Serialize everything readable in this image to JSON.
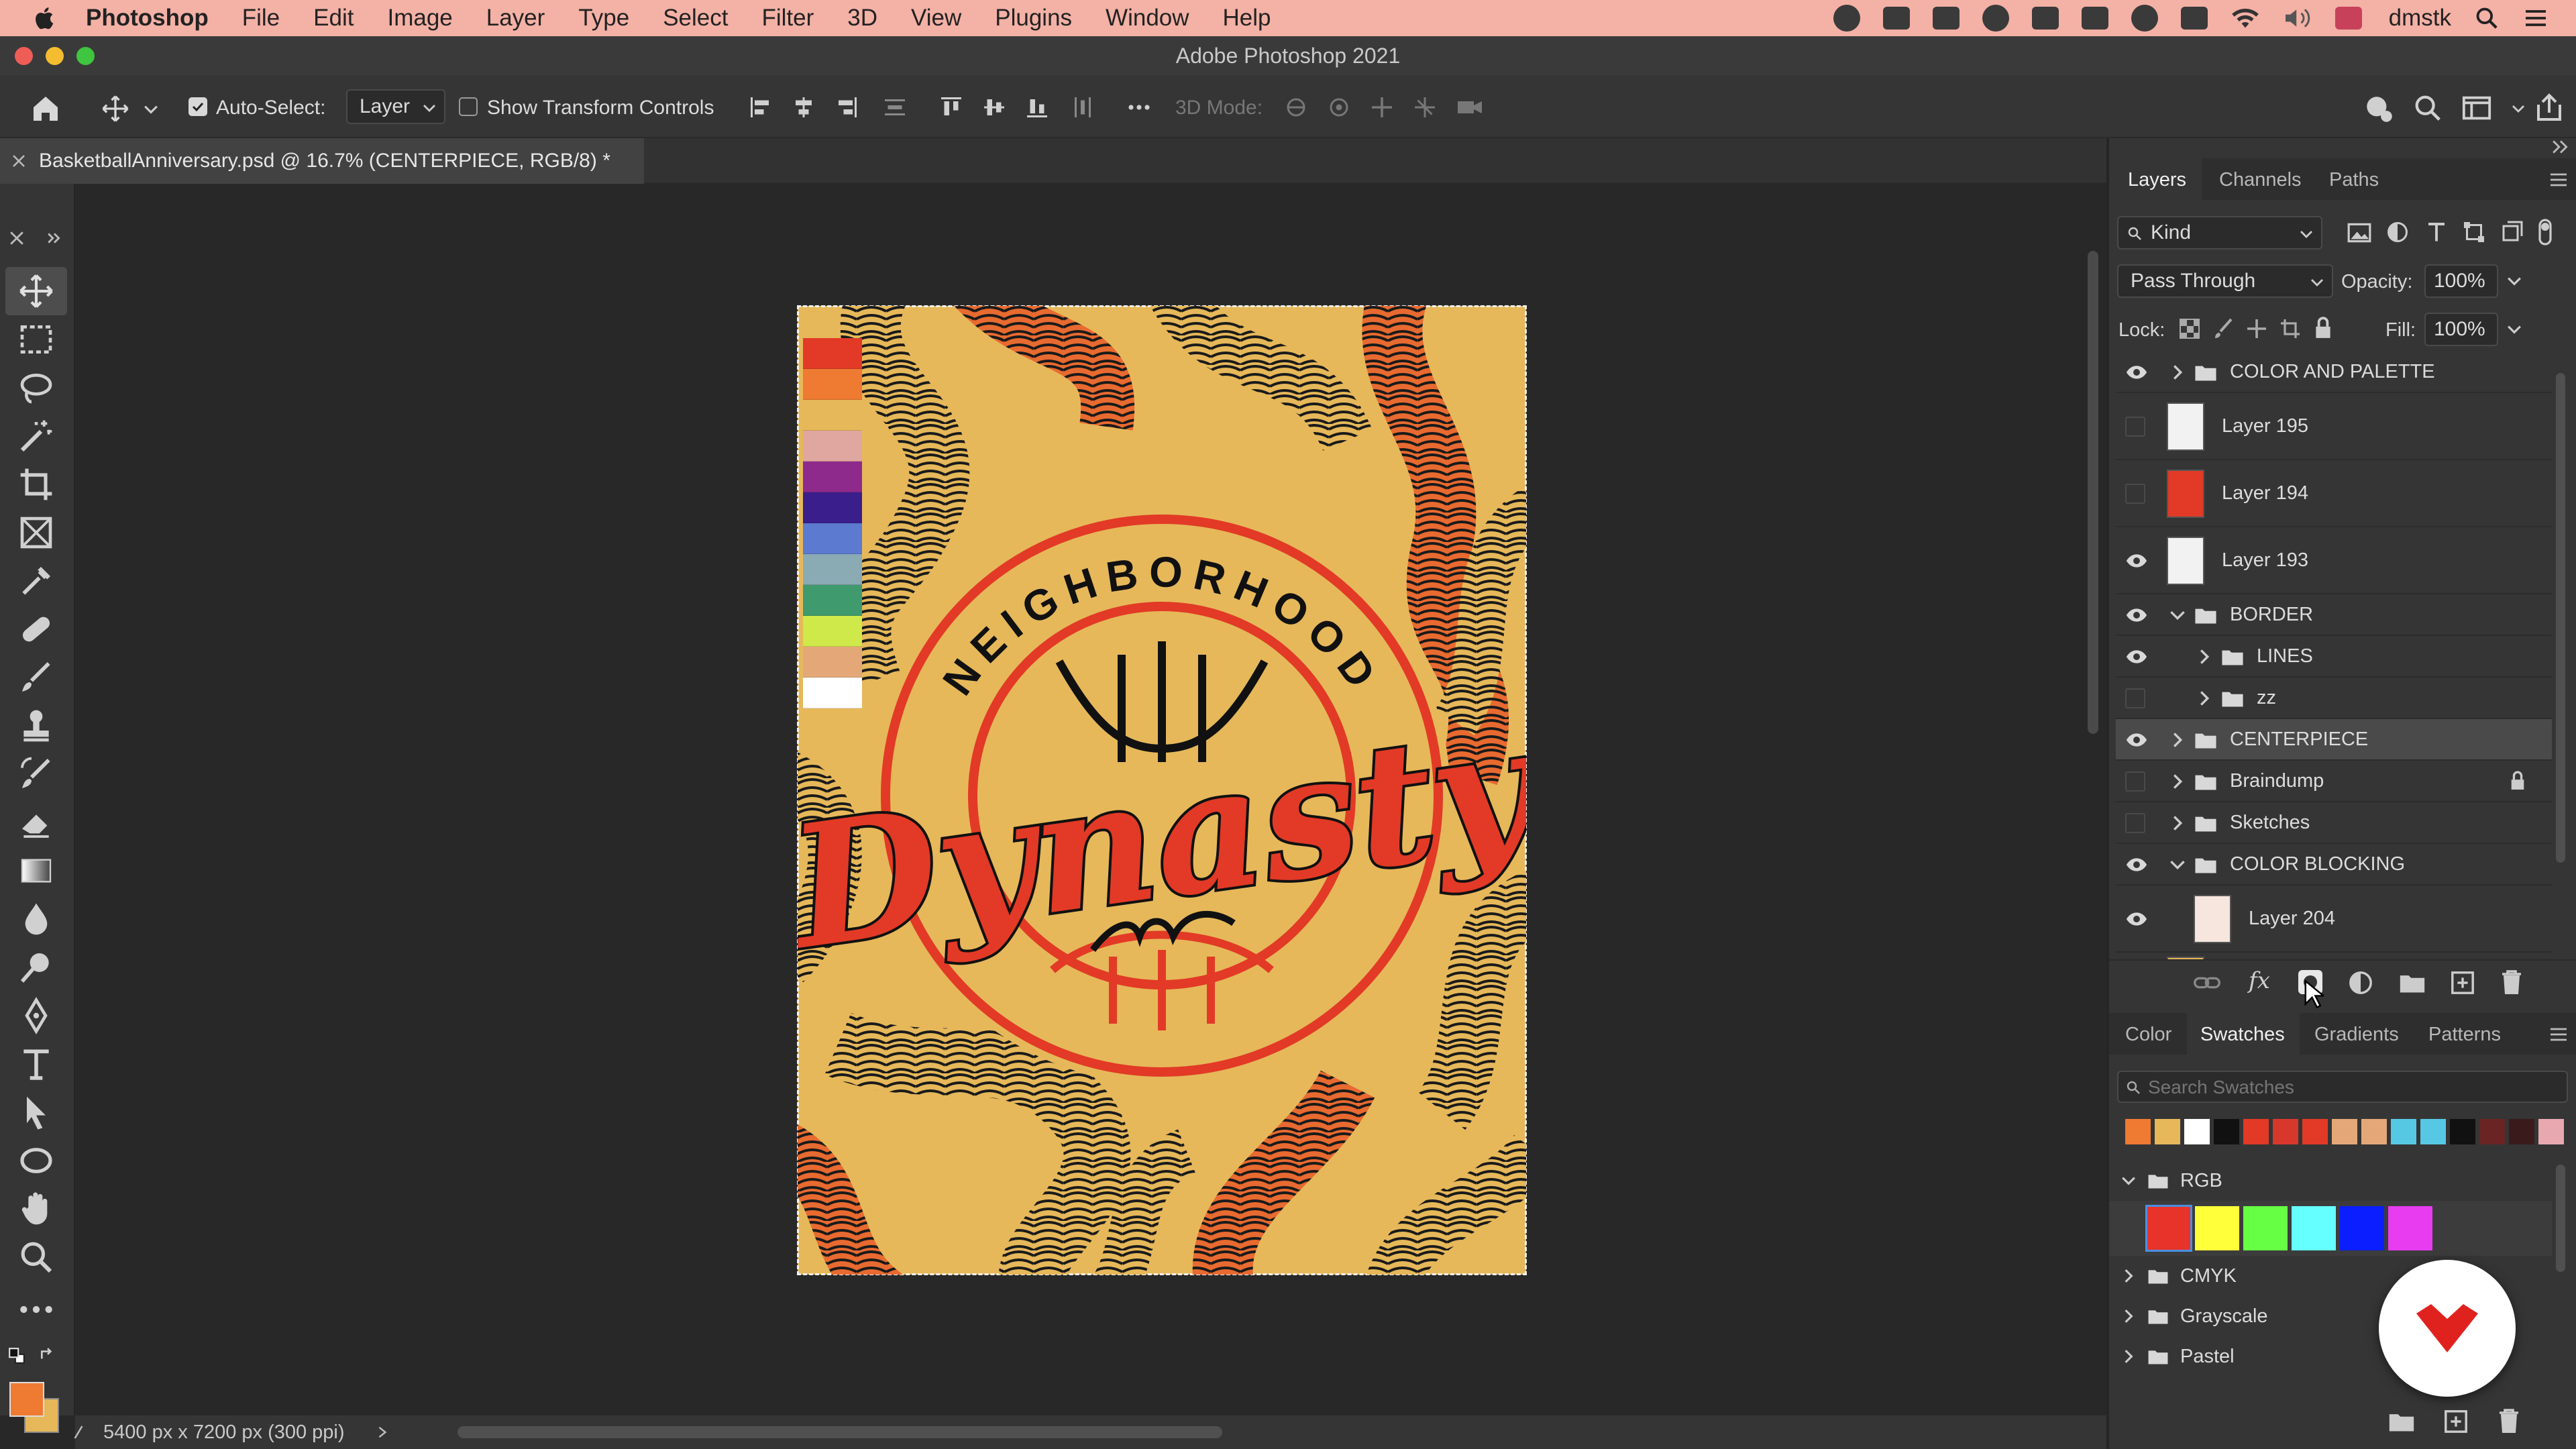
{
  "menubar": {
    "app": "Photoshop",
    "items": [
      "File",
      "Edit",
      "Image",
      "Layer",
      "Type",
      "Select",
      "Filter",
      "3D",
      "View",
      "Plugins",
      "Window",
      "Help"
    ],
    "user": "dmstk"
  },
  "window": {
    "title": "Adobe Photoshop 2021"
  },
  "options": {
    "auto_select_label": "Auto-Select:",
    "auto_select_checked": true,
    "auto_select_value": "Layer",
    "transform_label": "Show Transform Controls",
    "transform_checked": false,
    "mode_3d_label": "3D Mode:"
  },
  "document": {
    "tab_title": "BasketballAnniversary.psd @ 16.7% (CENTERPIECE, RGB/8) *"
  },
  "status": {
    "dimensions": "5400 px x 7200 px (300 ppi)"
  },
  "artwork": {
    "top_text": "NEIGHBORHOOD",
    "script_text": "Dynasty",
    "palette": [
      "#e23a26",
      "#ef7a32",
      "#e6b85a",
      "#e0a6a0",
      "#8e2a8c",
      "#3a1e8c",
      "#5c7ad0",
      "#8aaab4",
      "#3f9a6e",
      "#cfe84a",
      "#e4a878",
      "#ffffff"
    ]
  },
  "layers_panel": {
    "tabs": [
      "Layers",
      "Channels",
      "Paths"
    ],
    "active_tab": "Layers",
    "filter_kind": "Kind",
    "blend_mode": "Pass Through",
    "opacity_label": "Opacity:",
    "opacity_value": "100%",
    "lock_label": "Lock:",
    "fill_label": "Fill:",
    "fill_value": "100%",
    "rows": [
      {
        "name": "COLOR AND PALETTE",
        "type": "group",
        "visible": true,
        "indent": 0,
        "expanded": false
      },
      {
        "name": "Layer 195",
        "type": "layer",
        "visible": false,
        "thumb": "#f2f2f2"
      },
      {
        "name": "Layer 194",
        "type": "layer",
        "visible": false,
        "thumb": "#e23a26"
      },
      {
        "name": "Layer 193",
        "type": "layer",
        "visible": true,
        "thumb": "#f2f2f2"
      },
      {
        "name": "BORDER",
        "type": "group",
        "visible": true,
        "indent": 0,
        "expanded": true
      },
      {
        "name": "LINES",
        "type": "group",
        "visible": true,
        "indent": 1,
        "expanded": false
      },
      {
        "name": "zz",
        "type": "group",
        "visible": false,
        "indent": 1,
        "expanded": false
      },
      {
        "name": "CENTERPIECE",
        "type": "group",
        "visible": true,
        "indent": 0,
        "expanded": false,
        "selected": true
      },
      {
        "name": "Braindump",
        "type": "group",
        "visible": false,
        "indent": 0,
        "expanded": false,
        "locked": true
      },
      {
        "name": "Sketches",
        "type": "group",
        "visible": false,
        "indent": 0,
        "expanded": false
      },
      {
        "name": "COLOR BLOCKING",
        "type": "group",
        "visible": true,
        "indent": 0,
        "expanded": true
      },
      {
        "name": "Layer 204",
        "type": "layer",
        "visible": true,
        "indent": 1,
        "thumb": "#f6e6de"
      }
    ]
  },
  "swatches_panel": {
    "tabs": [
      "Color",
      "Swatches",
      "Gradients",
      "Patterns"
    ],
    "active_tab": "Swatches",
    "search_placeholder": "Search Swatches",
    "recent": [
      "#ef7a32",
      "#e6b85a",
      "#ffffff",
      "#111111",
      "#e23a26",
      "#d8382c",
      "#e23a26",
      "#e4a878",
      "#e4a878",
      "#56c8e4",
      "#56c8e4",
      "#111111",
      "#6a2424",
      "#3a1a1a",
      "#e8a8b0"
    ],
    "groups": [
      {
        "name": "RGB",
        "expanded": true,
        "colors": [
          "#e8332a",
          "#ffff3a",
          "#66ff44",
          "#66ffff",
          "#0a1eff",
          "#e83cf0"
        ]
      },
      {
        "name": "CMYK",
        "expanded": false
      },
      {
        "name": "Grayscale",
        "expanded": false
      },
      {
        "name": "Pastel",
        "expanded": false
      }
    ]
  }
}
